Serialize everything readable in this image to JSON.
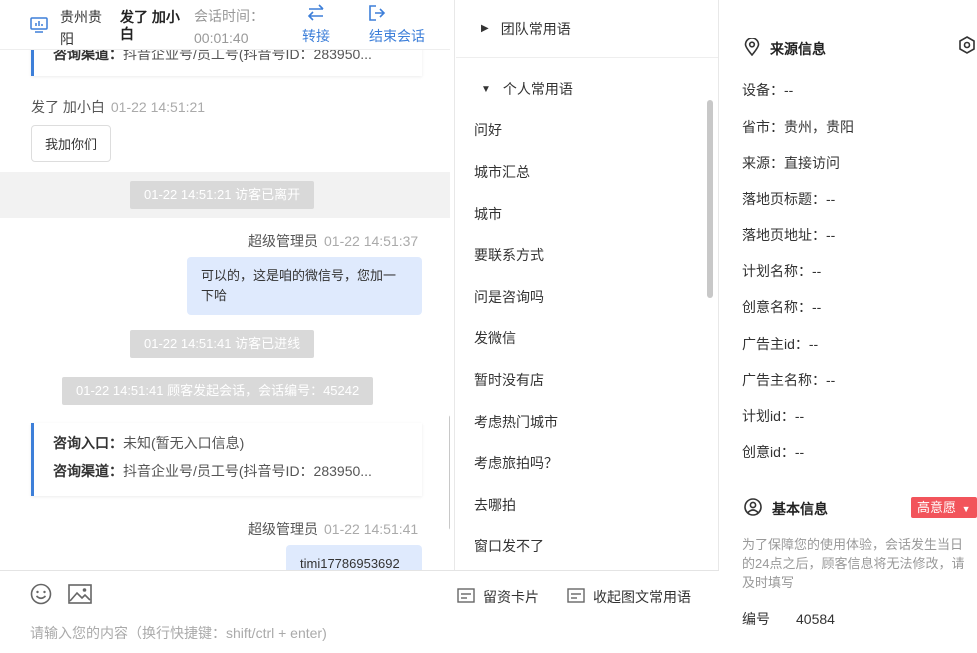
{
  "header": {
    "city": "贵州贵阳",
    "visitor_name": "发了 加小白",
    "session_time_label": "会话时间：",
    "session_time": "00:01:40",
    "transfer_label": "转接",
    "end_label": "结束会话"
  },
  "chat": {
    "card_top": {
      "channel_key": "咨询渠道：",
      "channel_val": "抖音企业号/员工号(抖音号ID：283950..."
    },
    "visitor_msg": {
      "sender": "发了 加小白",
      "time": "01-22 14:51:21",
      "text": "我加你们"
    },
    "sys_left": "01-22 14:51:21 访客已离开",
    "agent_msg1": {
      "sender": "超级管理员",
      "time": "01-22 14:51:37",
      "text": "可以的，这是咱的微信号，您加一下哈"
    },
    "sys_online": "01-22 14:51:41 访客已进线",
    "sys_session": "01-22 14:51:41 顾客发起会话，会话编号：45242",
    "card_bottom": {
      "entry_key": "咨询入口：",
      "entry_val": "未知(暂无入口信息)",
      "channel_key": "咨询渠道：",
      "channel_val": "抖音企业号/员工号(抖音号ID：283950..."
    },
    "agent_msg2": {
      "sender": "超级管理员",
      "time": "01-22 14:51:41",
      "text": "timi17786953692"
    }
  },
  "input": {
    "card_label": "留资卡片",
    "collapse_label": "收起图文常用语",
    "placeholder": "请输入您的内容（换行快捷键：shift/ctrl + enter)"
  },
  "phrases": {
    "team_group": "团队常用语",
    "personal_group": "个人常用语",
    "items": [
      "问好",
      "城市汇总",
      "城市",
      "要联系方式",
      "问是咨询吗",
      "发微信",
      "暂时没有店",
      "考虑热门城市",
      "考虑旅拍吗？",
      "去哪拍",
      "窗口发不了"
    ]
  },
  "source_info": {
    "title": "来源信息",
    "rows": [
      "设备：--",
      "省市：贵州，贵阳",
      "来源：直接访问",
      "落地页标题：--",
      "落地页地址：--",
      "计划名称：--",
      "创意名称：--",
      "广告主id：--",
      "广告主名称：--",
      "计划id：--",
      "创意id：--"
    ]
  },
  "basic_info": {
    "title": "基本信息",
    "intent_badge": "高意愿",
    "notice": "为了保障您的使用体验，会话发生当日的24点之后，顾客信息将无法修改，请及时填写",
    "id_label": "编号",
    "id_value": "40584"
  },
  "colors": {
    "accent": "#3d7fd9",
    "agent_bubble": "#dfeafd",
    "badge": "#f2545b",
    "system": "#d9d9d9"
  }
}
